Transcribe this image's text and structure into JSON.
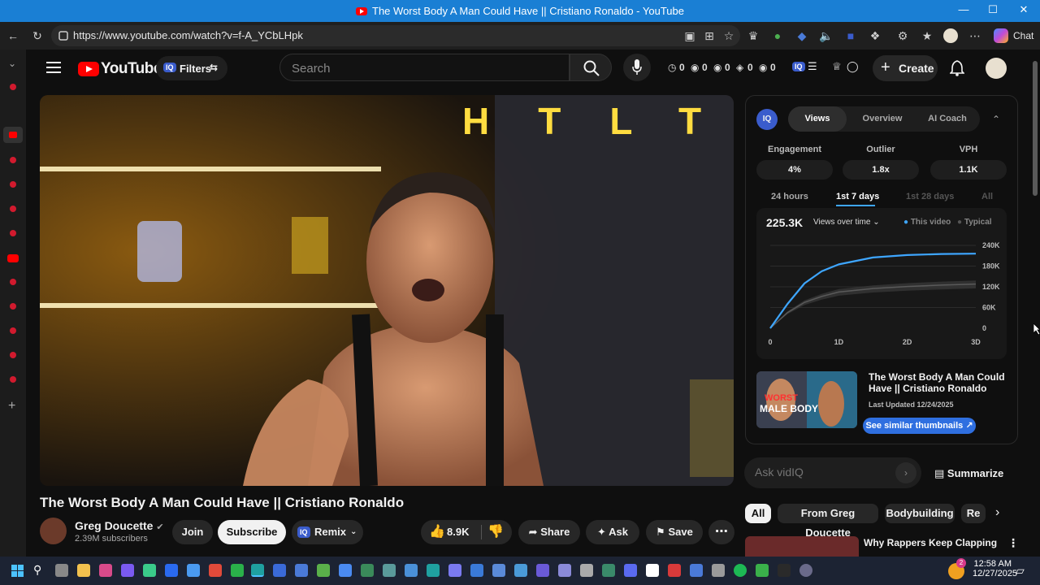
{
  "window": {
    "title": "The Worst Body A Man Could Have || Cristiano Ronaldo - YouTube"
  },
  "browser": {
    "url": "https://www.youtube.com/watch?v=f-A_YCbLHpk",
    "chat_label": "Chat"
  },
  "header": {
    "logo_text": "YouTube",
    "filters_label": "Filters",
    "iq_label": "IQ",
    "search_placeholder": "Search",
    "stats": [
      "0",
      "0",
      "0",
      "0",
      "0"
    ],
    "create_label": "Create"
  },
  "video": {
    "title": "The Worst Body A Man Could Have || Cristiano Ronaldo",
    "overlay_letters": "HTLT",
    "channel_name": "Greg Doucette",
    "subscribers": "2.39M subscribers",
    "join_label": "Join",
    "subscribe_label": "Subscribe",
    "remix_label": "Remix",
    "likes": "8.9K",
    "share_label": "Share",
    "ask_label": "Ask",
    "save_label": "Save"
  },
  "vidiq": {
    "logo": "IQ",
    "tabs": [
      "Views",
      "Overview",
      "AI Coach"
    ],
    "active_tab": "Views",
    "metrics": [
      {
        "label": "Engagement",
        "value": "4%"
      },
      {
        "label": "Outlier",
        "value": "1.8x"
      },
      {
        "label": "VPH",
        "value": "1.1K"
      }
    ],
    "ranges": [
      "24 hours",
      "1st 7 days",
      "1st 28 days",
      "All"
    ],
    "active_range": "1st 7 days",
    "total_views": "225.3K",
    "chart_mode": "Views over time",
    "legend": [
      "This video",
      "Typical"
    ],
    "similar": {
      "title": "The Worst Body A Man Could Have || Cristiano Ronaldo",
      "updated": "Last Updated 12/24/2025",
      "button": "See similar thumbnails",
      "thumb_text_1": "WORST",
      "thumb_text_2": "MALE BODY"
    },
    "ask_placeholder": "Ask vidIQ",
    "summarize_label": "Summarize"
  },
  "chips": [
    "All",
    "From Greg Doucette",
    "Bodybuilding",
    "Re"
  ],
  "next_video_title": "Why Rappers Keep Clapping",
  "taskbar": {
    "time": "12:58 AM",
    "date": "12/27/2025",
    "weather_badge": "2"
  },
  "colors": {
    "accent_blue": "#3ea6ff",
    "youtube_red": "#ff0000",
    "vidiq_blue": "#3a5ccc"
  },
  "chart_data": {
    "type": "line",
    "x_ticks": [
      "0",
      "1D",
      "2D",
      "3D"
    ],
    "y_ticks": [
      "0",
      "60K",
      "120K",
      "180K",
      "240K"
    ],
    "ylim": [
      0,
      240000
    ],
    "xlim": [
      0,
      3
    ],
    "series": [
      {
        "name": "This video",
        "x": [
          0,
          0.25,
          0.5,
          0.75,
          1.0,
          1.5,
          2.0,
          2.5,
          3.0
        ],
        "values": [
          0,
          70000,
          130000,
          165000,
          185000,
          205000,
          212000,
          215000,
          216000
        ]
      },
      {
        "name": "Typical",
        "x": [
          0,
          0.25,
          0.5,
          0.75,
          1.0,
          1.5,
          2.0,
          2.5,
          3.0
        ],
        "values": [
          0,
          45000,
          75000,
          92000,
          105000,
          115000,
          121000,
          125000,
          128000
        ]
      }
    ]
  }
}
